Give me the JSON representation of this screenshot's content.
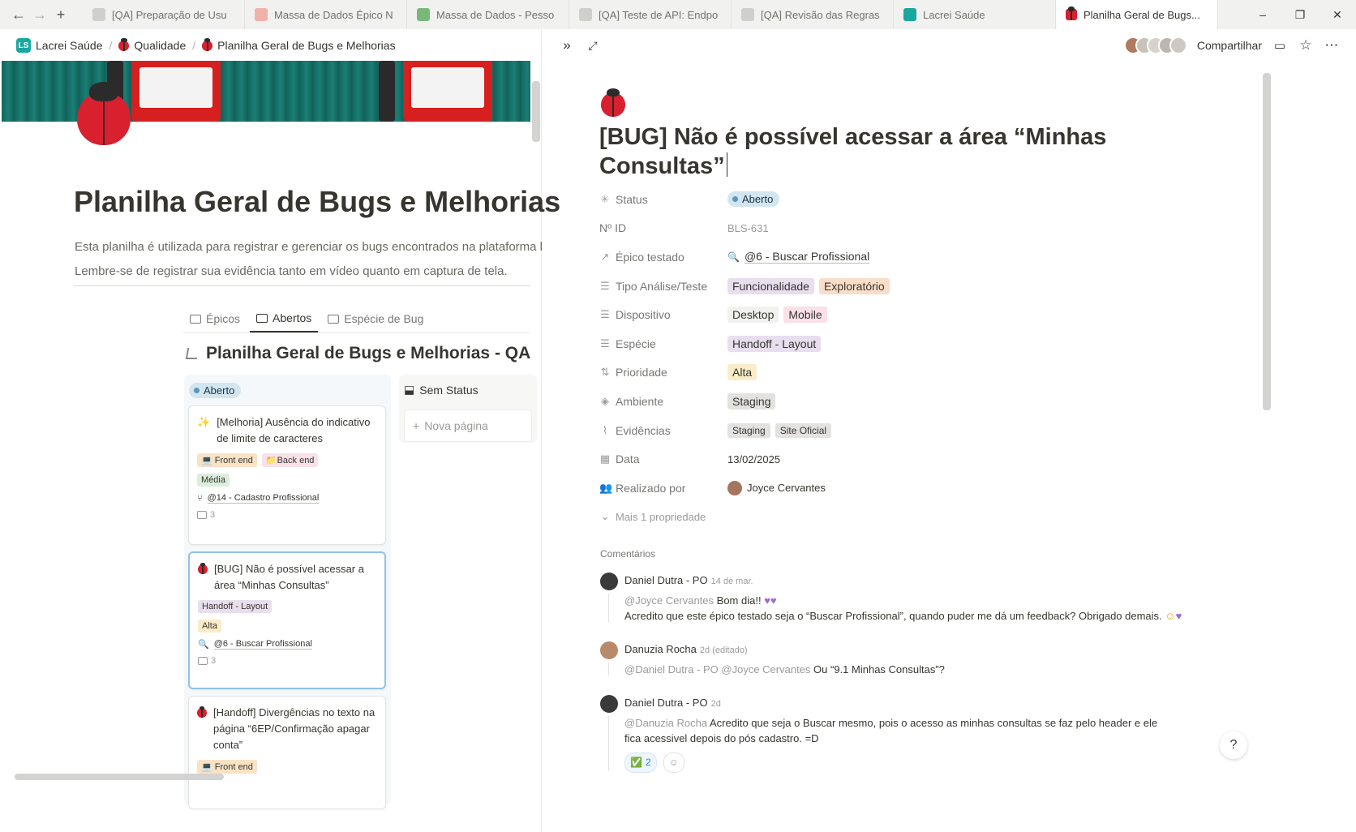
{
  "tabs": [
    {
      "label": "[QA] Preparação de Usu",
      "active": false
    },
    {
      "label": "Massa de Dados Épico N",
      "active": false
    },
    {
      "label": "Massa de Dados - Pesso",
      "active": false
    },
    {
      "label": "[QA] Teste de API: Endpo",
      "active": false
    },
    {
      "label": "[QA] Revisão das Regras",
      "active": false
    },
    {
      "label": "Lacrei Saúde",
      "active": false
    },
    {
      "label": "Planilha Geral de Bugs...",
      "active": true
    }
  ],
  "window": {
    "minimize": "–",
    "restore": "❐",
    "close": "✕"
  },
  "left": {
    "breadcrumb": [
      "Lacrei Saúde",
      "Qualidade",
      "Planilha Geral de Bugs e Melhorias"
    ],
    "page_title": "Planilha Geral de Bugs e Melhorias",
    "description": [
      "Esta planilha é utilizada para registrar e gerenciar os bugs encontrados na plataforma l",
      "Lembre-se de registrar sua evidência tanto em vídeo quanto em captura de tela."
    ],
    "views": [
      "Épicos",
      "Abertos",
      "Espécie de Bug"
    ],
    "db_title": "Planilha Geral de Bugs e Melhorias - QA",
    "column_open": "Aberto",
    "column_none": "Sem Status",
    "new_page": "Nova página",
    "cards": [
      {
        "title": "[Melhoria] Ausência do indicativo de limite de caracteres",
        "tags": [
          "Front end",
          "Back end"
        ],
        "priority": "Média",
        "link": "@14 - Cadastro Profissional",
        "comments": "3"
      },
      {
        "title": "[BUG] Não é possível acessar a área “Minhas Consultas”",
        "tags": [
          "Handoff - Layout"
        ],
        "priority": "Alta",
        "link": "@6 - Buscar Profissional",
        "comments": "3"
      },
      {
        "title": "[Handoff] Divergências no texto na página “6EP/Confirmação apagar conta”",
        "tags": [
          "Front end"
        ]
      }
    ]
  },
  "right": {
    "share": "Compartilhar",
    "title": "[BUG] Não é possível acessar a área “Minhas Consultas”",
    "properties": {
      "status": {
        "label": "Status",
        "value": "Aberto"
      },
      "id": {
        "label": "Nº ID",
        "value": "BLS-631"
      },
      "epico": {
        "label": "Épico testado",
        "value": "@6 - Buscar Profissional"
      },
      "tipo": {
        "label": "Tipo Análise/Teste",
        "values": [
          "Funcionalidade",
          "Exploratório"
        ]
      },
      "dispositivo": {
        "label": "Dispositivo",
        "values": [
          "Desktop",
          "Mobile"
        ]
      },
      "especie": {
        "label": "Espécie",
        "value": "Handoff - Layout"
      },
      "prioridade": {
        "label": "Prioridade",
        "value": "Alta"
      },
      "ambiente": {
        "label": "Ambiente",
        "value": "Staging"
      },
      "evidencias": {
        "label": "Evidências",
        "values": [
          "Staging",
          "Site Oficial"
        ]
      },
      "data": {
        "label": "Data",
        "value": "13/02/2025"
      },
      "realizado": {
        "label": "Realizado por",
        "value": "Joyce Cervantes"
      },
      "more": "Mais 1 propriedade"
    },
    "comments_heading": "Comentários",
    "comments": [
      {
        "author": "Daniel Dutra - PO",
        "time": "14 de mar.",
        "line1_mention": "@Joyce Cervantes",
        "line1_text": "Bom dia!!",
        "line2": "Acredito que este épico testado seja o “Buscar Profissional”, quando puder me dá um feedback? Obrigado demais."
      },
      {
        "author": "Danuzia Rocha",
        "time": "2d (editado)",
        "mentions": "@Daniel Dutra - PO @Joyce Cervantes",
        "text": "Ou “9.1 Minhas Consultas”?"
      },
      {
        "author": "Daniel Dutra - PO",
        "time": "2d",
        "mention": "@Danuzia Rocha",
        "text": "Acredito que seja o Buscar mesmo, pois o acesso as minhas consultas se faz pelo header e ele fica acessivel depois do pós cadastro. =D",
        "reaction_count": "2"
      }
    ],
    "help": "?"
  }
}
